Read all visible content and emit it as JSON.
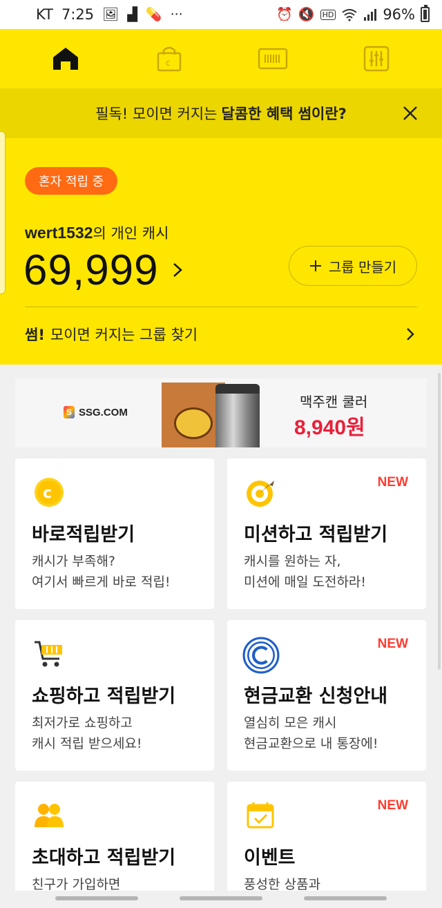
{
  "status_bar": {
    "carrier": "KT",
    "time": "7:25",
    "battery": "96%",
    "left_icons": [
      "image-icon",
      "stairs-icon",
      "pill-icon",
      "more-dots-icon"
    ],
    "right_icons": [
      "alarm-icon",
      "mute-icon",
      "hd-icon",
      "wifi-icon",
      "signal-icon",
      "battery-icon"
    ]
  },
  "top_nav": {
    "items": [
      {
        "icon": "home-icon",
        "active": true
      },
      {
        "icon": "shopping-bag-icon",
        "active": false
      },
      {
        "icon": "barcode-icon",
        "active": false
      },
      {
        "icon": "settings-sliders-icon",
        "active": false
      }
    ]
  },
  "banner": {
    "text_prefix": "필독! 모이면 커지는",
    "text_bold": "달콤한 혜택 썸이란?"
  },
  "account": {
    "status_pill": "혼자 적립 중",
    "username": "wert1532",
    "owner_suffix": "의 개인 캐시",
    "cash": "69,999",
    "group_button": "그룹 만들기",
    "find_bold": "썸!",
    "find_text": "모이면 커지는 그룹 찾기"
  },
  "ad": {
    "brand": "SSG.COM",
    "product": "맥주캔 쿨러",
    "price": "8,940원"
  },
  "cards": [
    {
      "icon": "coin-c-icon",
      "title": "바로적립받기",
      "desc": "캐시가 부족해?\n여기서 빠르게 바로 적립!",
      "new": ""
    },
    {
      "icon": "target-mission-icon",
      "title": "미션하고 적립받기",
      "desc": "캐시를 원하는 자,\n미션에 매일 도전하라!",
      "new": "NEW"
    },
    {
      "icon": "shopping-cart-icon",
      "title": "쇼핑하고 적립받기",
      "desc": "최저가로 쇼핑하고\n캐시 적립 받으세요!",
      "new": ""
    },
    {
      "icon": "cash-exchange-icon",
      "title": "현금교환 신청안내",
      "desc": "열심히 모은 캐시\n현금교환으로 내 통장에!",
      "new": "NEW"
    },
    {
      "icon": "invite-friends-icon",
      "title": "초대하고 적립받기",
      "desc": "친구가 가입하면",
      "new": ""
    },
    {
      "icon": "calendar-event-icon",
      "title": "이벤트",
      "desc": "풍성한 상품과",
      "new": "NEW"
    }
  ],
  "colors": {
    "brand_yellow": "#ffe600",
    "banner_yellow": "#ecd600",
    "pill_orange": "#ff6a13",
    "new_red": "#ff3b2f",
    "price_red": "#e8203a"
  }
}
